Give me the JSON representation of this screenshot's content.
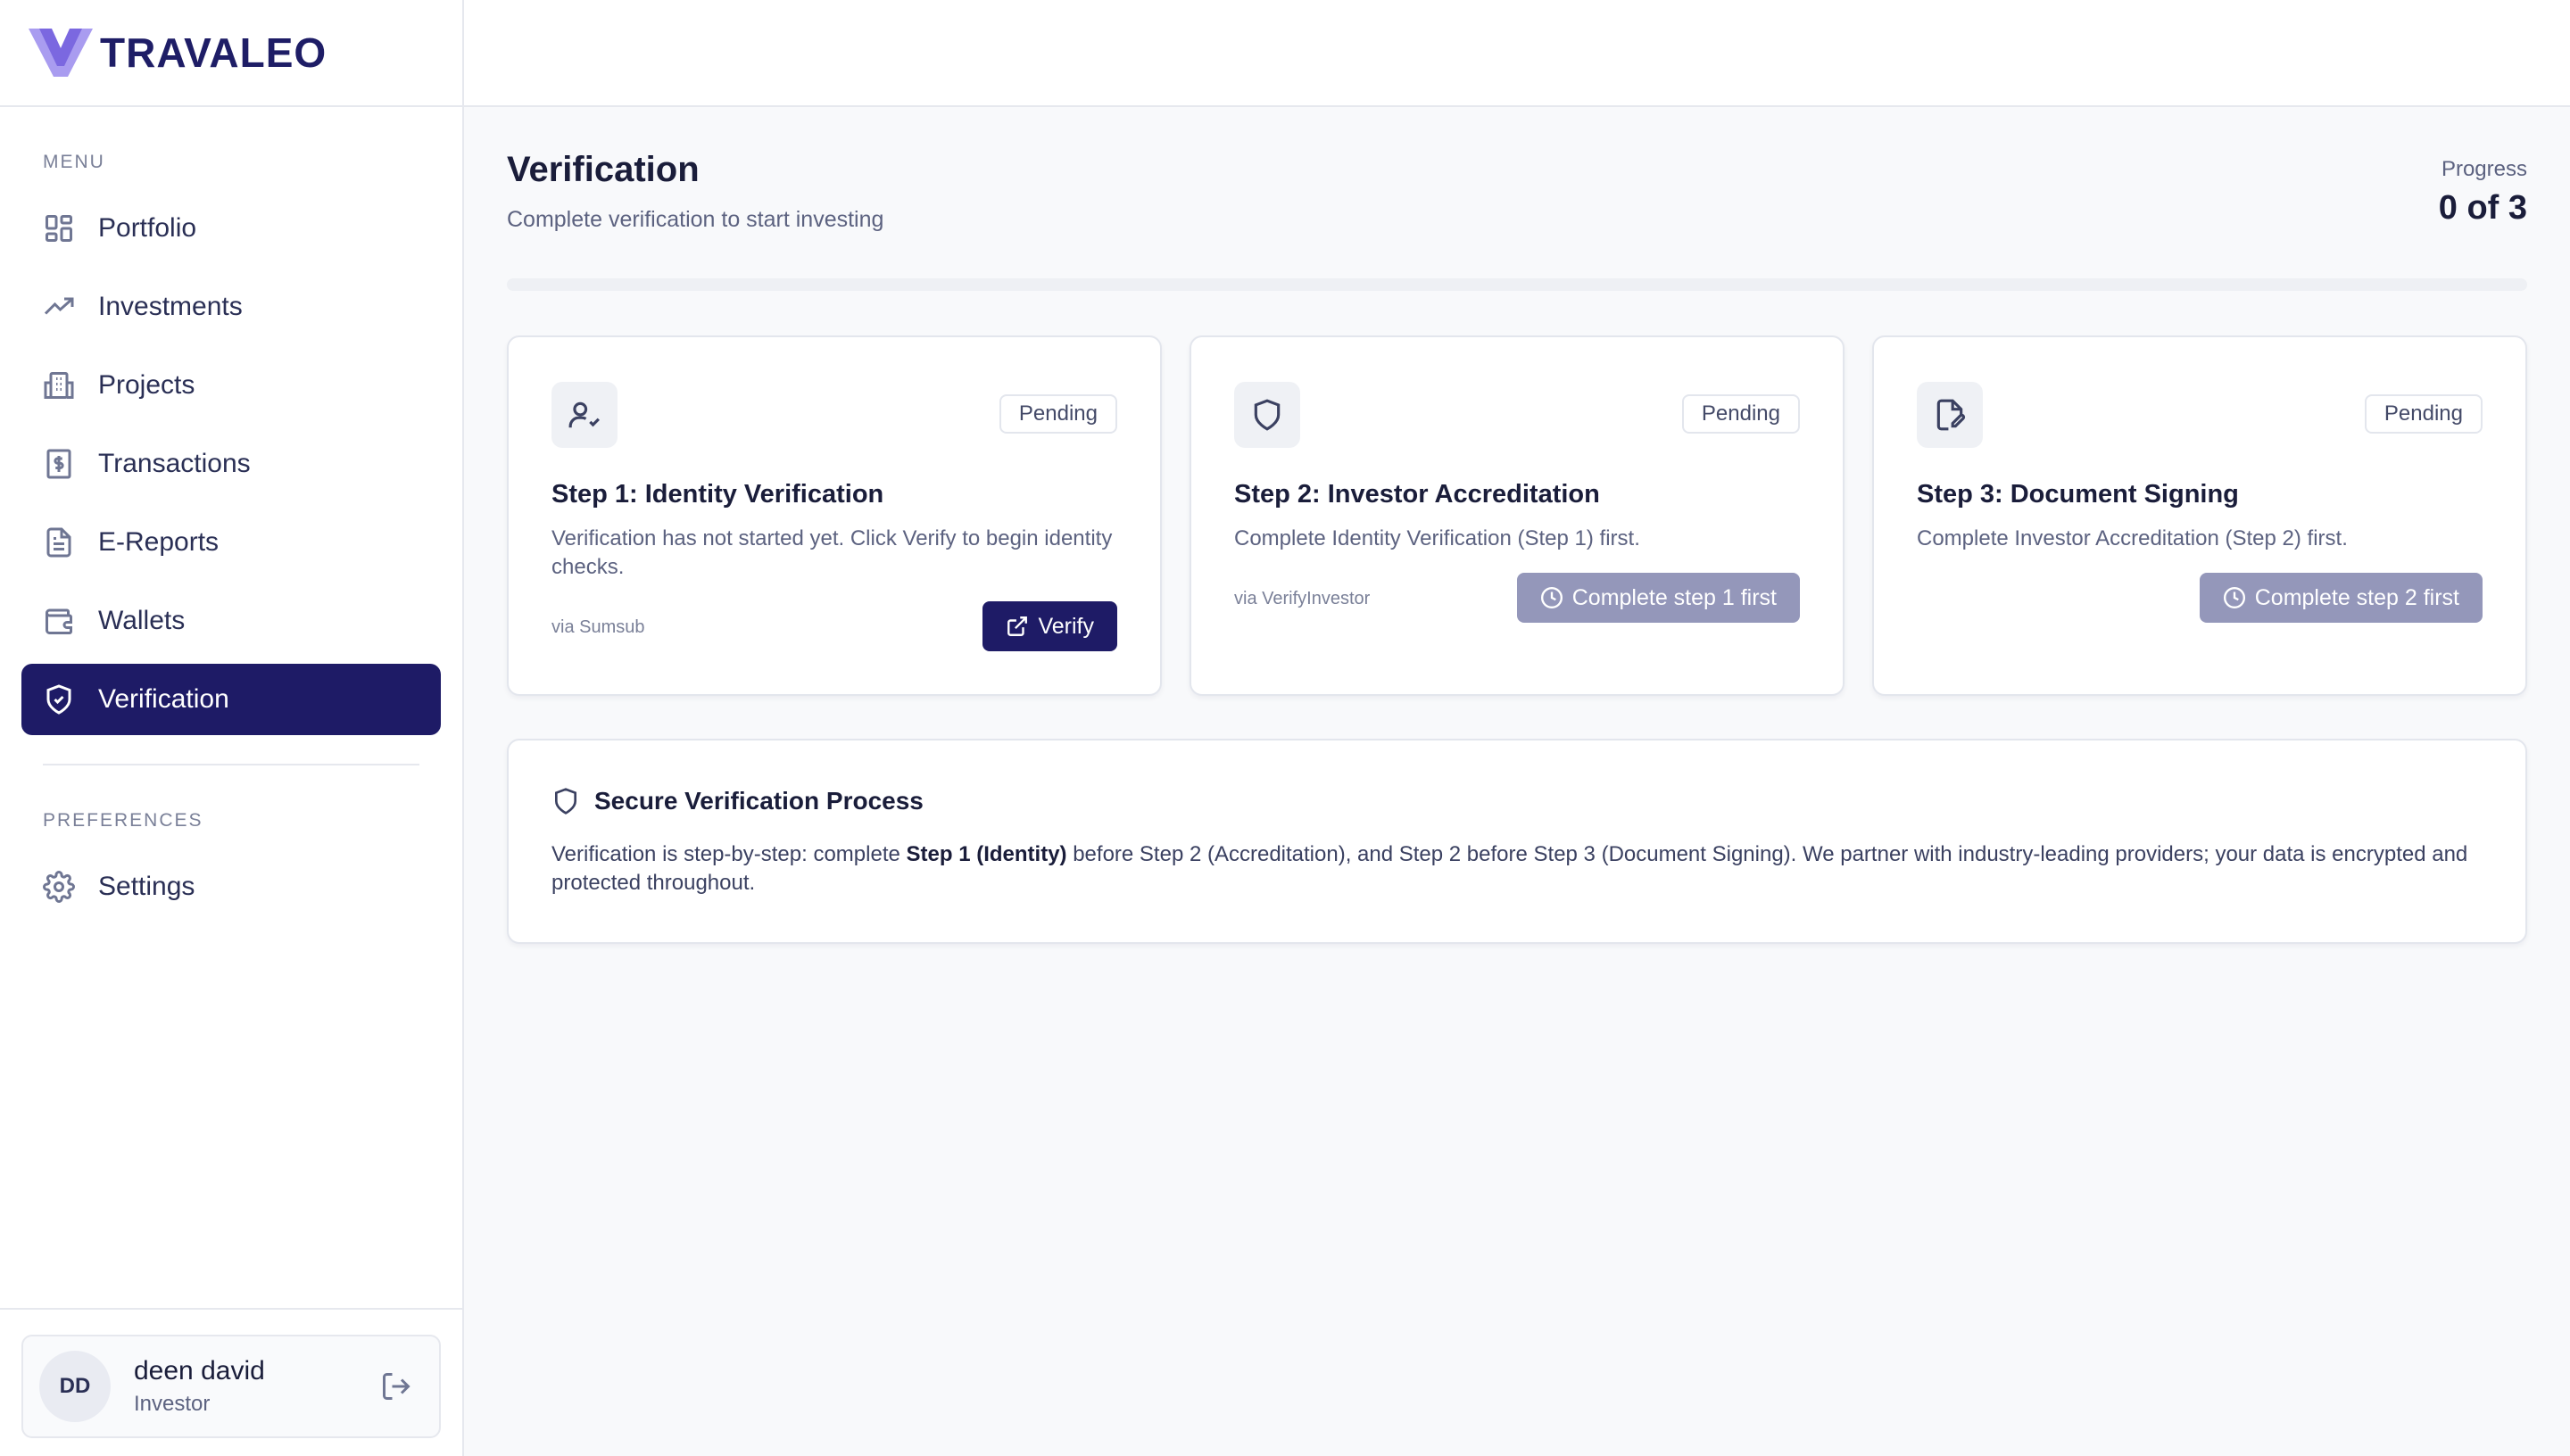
{
  "brand": {
    "name": "TRAVALEO",
    "color": "#1e1d66",
    "accent": "#8b7be8"
  },
  "sidebar": {
    "menu_label": "MENU",
    "items": [
      {
        "label": "Portfolio",
        "icon": "grid-icon"
      },
      {
        "label": "Investments",
        "icon": "trending-up-icon"
      },
      {
        "label": "Projects",
        "icon": "building-icon"
      },
      {
        "label": "Transactions",
        "icon": "dollar-receipt-icon"
      },
      {
        "label": "E-Reports",
        "icon": "file-text-icon"
      },
      {
        "label": "Wallets",
        "icon": "wallet-icon"
      },
      {
        "label": "Verification",
        "icon": "shield-check-icon",
        "active": true
      }
    ],
    "preferences_label": "PREFERENCES",
    "settings_label": "Settings"
  },
  "user": {
    "initials": "DD",
    "name": "deen david",
    "role": "Investor"
  },
  "page": {
    "title": "Verification",
    "subtitle": "Complete verification to start investing",
    "progress_label": "Progress",
    "progress_value": "0 of 3",
    "progress_fraction": 0
  },
  "steps": [
    {
      "title": "Step 1: Identity Verification",
      "status": "Pending",
      "description": "Verification has not started yet. Click Verify to begin identity checks.",
      "provider": "via Sumsub",
      "button": "Verify",
      "icon": "user-check-icon"
    },
    {
      "title": "Step 2: Investor Accreditation",
      "status": "Pending",
      "description": "Complete Identity Verification (Step 1) first.",
      "provider": "via VerifyInvestor",
      "button": "Complete step 1 first",
      "icon": "shield-icon"
    },
    {
      "title": "Step 3: Document Signing",
      "status": "Pending",
      "description": "Complete Investor Accreditation (Step 2) first.",
      "provider": "",
      "button": "Complete step 2 first",
      "icon": "file-sign-icon"
    }
  ],
  "info": {
    "title": "Secure Verification Process",
    "body_prefix": "Verification is step-by-step: complete ",
    "body_bold": "Step 1 (Identity)",
    "body_suffix": " before Step 2 (Accreditation), and Step 2 before Step 3 (Document Signing). We partner with industry-leading providers; your data is encrypted and protected throughout."
  }
}
